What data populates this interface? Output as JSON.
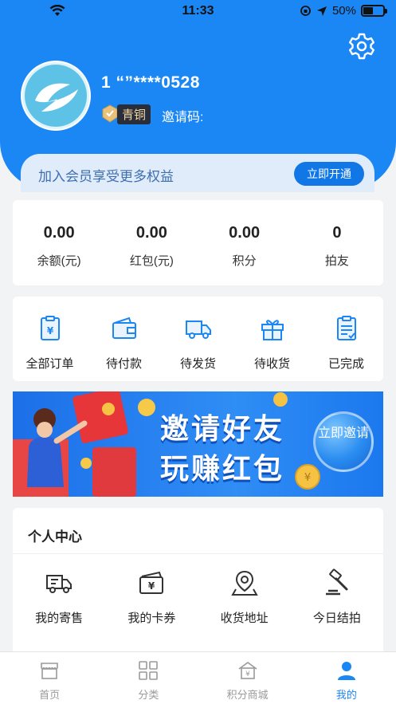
{
  "status_bar": {
    "time": "11:33",
    "battery": "50%"
  },
  "profile": {
    "phone": "1 “”****0528",
    "level": "青铜",
    "invite_code_label": "邀请码:"
  },
  "member": {
    "text": "加入会员享受更多权益",
    "button": "立即开通"
  },
  "stats": [
    {
      "value": "0.00",
      "label": "余额(元)"
    },
    {
      "value": "0.00",
      "label": "红包(元)"
    },
    {
      "value": "0.00",
      "label": "积分"
    },
    {
      "value": "0",
      "label": "拍友"
    }
  ],
  "orders": [
    {
      "label": "全部订单",
      "icon": "order-icon"
    },
    {
      "label": "待付款",
      "icon": "wallet-icon"
    },
    {
      "label": "待发货",
      "icon": "truck-icon"
    },
    {
      "label": "待收货",
      "icon": "gift-icon"
    },
    {
      "label": "已完成",
      "icon": "checklist-icon"
    }
  ],
  "banner": {
    "line1": "邀请好友",
    "line2": "玩赚红包",
    "bubble": "立即邀请"
  },
  "personal_center": {
    "title": "个人中心",
    "items": [
      {
        "label": "我的寄售",
        "icon": "consign-truck-icon"
      },
      {
        "label": "我的卡券",
        "icon": "coupon-icon"
      },
      {
        "label": "收货地址",
        "icon": "location-icon"
      },
      {
        "label": "今日结拍",
        "icon": "auction-hammer-icon"
      }
    ]
  },
  "tabbar": [
    {
      "label": "首页",
      "icon": "shop-icon"
    },
    {
      "label": "分类",
      "icon": "grid-icon"
    },
    {
      "label": "积分商城",
      "icon": "points-store-icon"
    },
    {
      "label": "我的",
      "icon": "user-icon"
    }
  ],
  "colors": {
    "primary": "#1a87f5",
    "accent_gold": "#f3d8a0",
    "text": "#222222"
  }
}
